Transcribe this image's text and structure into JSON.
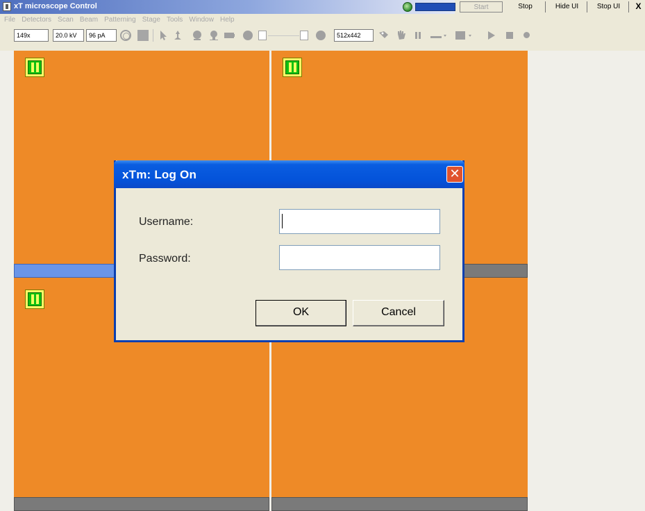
{
  "window": {
    "title": "xT microscope Control",
    "controls": {
      "start": "Start",
      "stop": "Stop",
      "hide_ui": "Hide UI",
      "stop_ui": "Stop UI",
      "close": "X"
    }
  },
  "menu": [
    "File",
    "Detectors",
    "Scan",
    "Beam",
    "Patterning",
    "Stage",
    "Tools",
    "Window",
    "Help"
  ],
  "toolbar": {
    "magnification": "149x",
    "voltage": "20.0 kV",
    "current": "96 pA",
    "resolution": "512x442"
  },
  "dialog": {
    "title": "xTm: Log On",
    "username_label": "Username:",
    "password_label": "Password:",
    "username_value": "",
    "password_value": "",
    "ok_label": "OK",
    "cancel_label": "Cancel",
    "close_glyph": "✕"
  },
  "colors": {
    "viewport": "#ee8a27",
    "pause_button": "#10c010",
    "active_bar": "#6a95e8",
    "inactive_bar": "#7a7a7a",
    "dialog_title": "#0453da"
  }
}
